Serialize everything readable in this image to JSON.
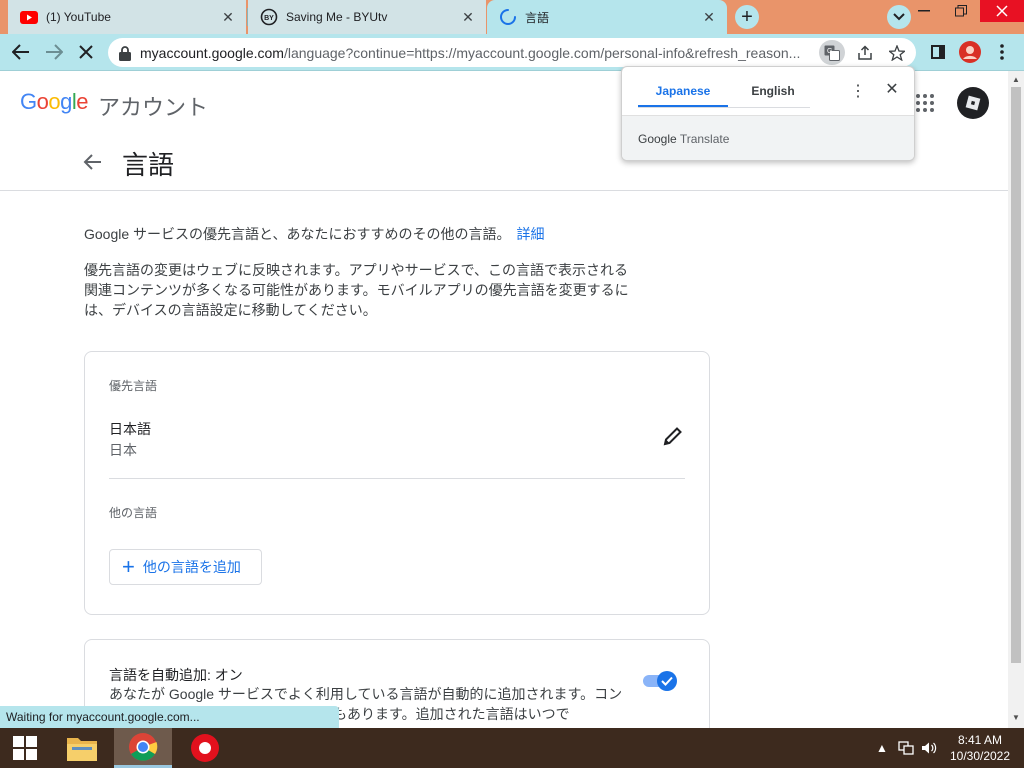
{
  "browser": {
    "tabs": [
      {
        "title": "(1) YouTube",
        "icon": "youtube-icon",
        "active": false
      },
      {
        "title": "Saving Me - BYUtv",
        "icon": "byutv-icon",
        "active": false
      },
      {
        "title": "言語",
        "icon": "loading-spinner-icon",
        "active": true
      }
    ],
    "new_tab_label": "+",
    "url_host": "myaccount.google.com",
    "url_path": "/language?continue=https://myaccount.google.com/personal-info&refresh_reason..."
  },
  "header": {
    "account_label": "アカウント"
  },
  "page": {
    "title": "言語",
    "intro": "Google サービスの優先言語と、あなたにおすすめのその他の言語。",
    "details_link": "詳細",
    "description": "優先言語の変更はウェブに反映されます。アプリやサービスで、この言語で表示される関連コンテンツが多くなる可能性があります。モバイルアプリの優先言語を変更するには、デバイスの言語設定に移動してください。",
    "preferred_label": "優先言語",
    "preferred_language": "日本語",
    "preferred_region": "日本",
    "other_label": "他の言語",
    "add_button": "他の言語を追加",
    "auto_add_heading": "言語を自動追加: オン",
    "auto_add_desc": "あなたが Google サービスでよく利用している言語が自動的に追加されます。コンテンツがその言語で表示されることもあります。追加された言語はいつで",
    "auto_add_enabled": true
  },
  "translate_popup": {
    "tab_source": "Japanese",
    "tab_target": "English",
    "selected": "Japanese",
    "brand": "Google",
    "product": "Translate"
  },
  "status_bar": "Waiting for myaccount.google.com...",
  "taskbar": {
    "time": "8:41 AM",
    "date": "10/30/2022"
  },
  "colors": {
    "titlebar": "#e9946a",
    "toolbar": "#b5e5ec",
    "accent": "#1a73e8",
    "taskbar": "#3d2a1e"
  }
}
